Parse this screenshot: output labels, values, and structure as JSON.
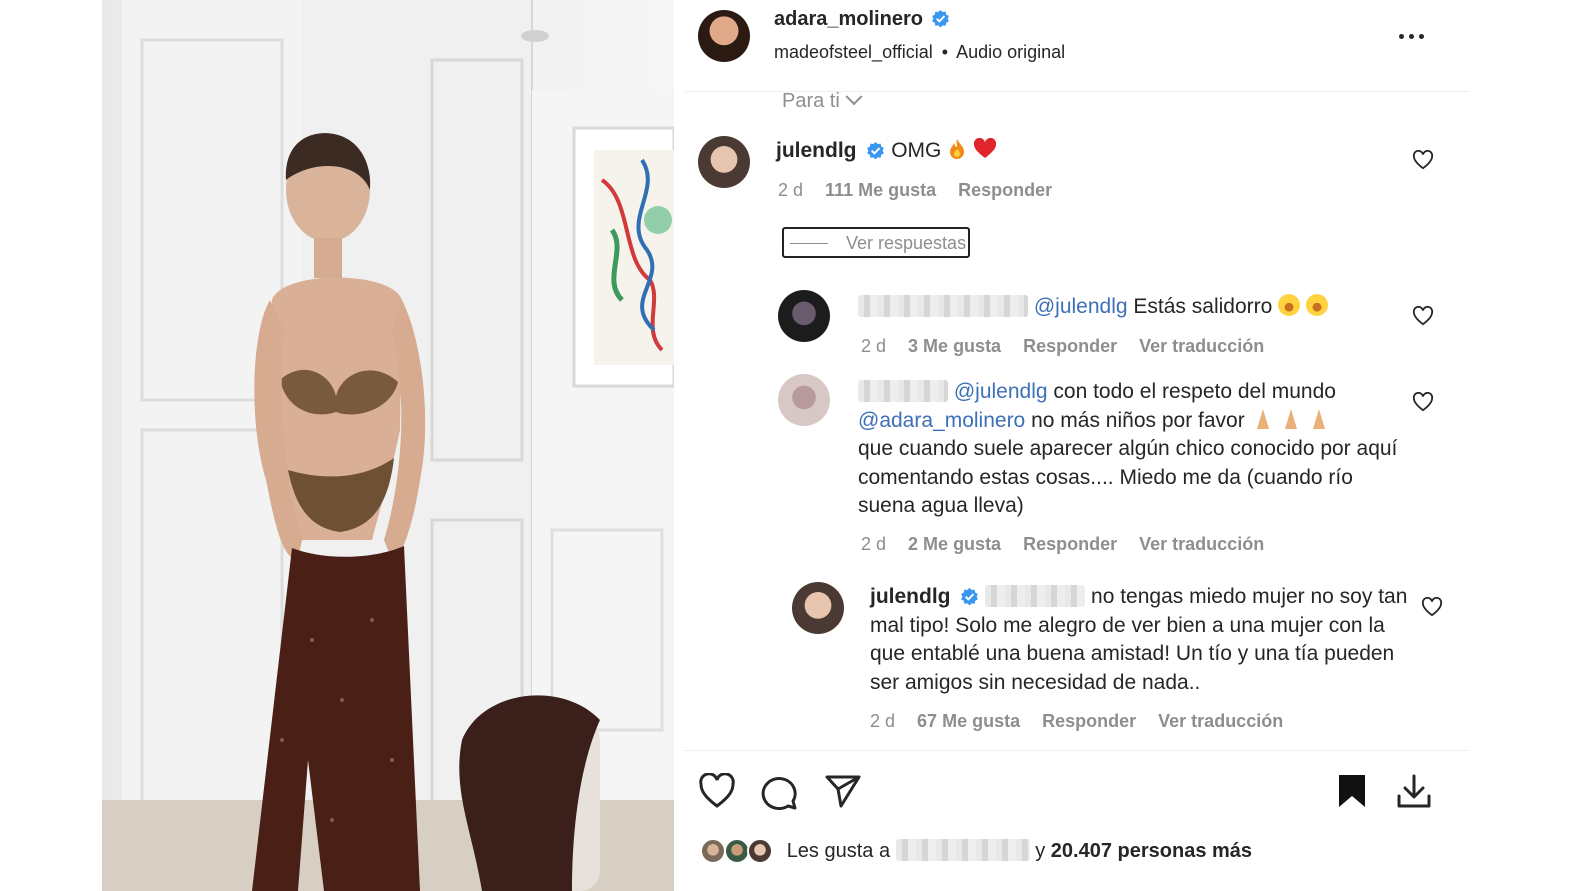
{
  "post": {
    "author": "adara_molinero",
    "audio_source": "madeofsteel_official",
    "audio_sep": "•",
    "audio_label": "Audio original"
  },
  "filter": {
    "label": "Para ti"
  },
  "comments": [
    {
      "user": "julendlg",
      "text": "OMG",
      "time": "2 d",
      "likes": "111 Me gusta",
      "reply": "Responder",
      "view_replies": "Ver respuestas"
    },
    {
      "mention": "@julendlg",
      "text": "Estás salidorro",
      "time": "2 d",
      "likes": "3 Me gusta",
      "reply": "Responder",
      "translate": "Ver traducción"
    },
    {
      "mention1": "@julendlg",
      "text1": "con todo el respeto del mundo",
      "mention2": "@adara_molinero",
      "text2": "no más niños por favor",
      "text3": "que cuando suele aparecer algún chico conocido por aquí comentando estas cosas.... Miedo me da (cuando río suena agua lleva)",
      "time": "2 d",
      "likes": "2 Me gusta",
      "reply": "Responder",
      "translate": "Ver traducción"
    },
    {
      "user": "julendlg",
      "text": "no tengas miedo mujer no soy tan mal tipo! Solo me alegro de ver bien a una mujer con la que entablé una buena amistad! Un tío y una tía pueden ser amigos sin necesidad de nada..",
      "time": "2 d",
      "likes": "67 Me gusta",
      "reply": "Responder",
      "translate": "Ver traducción"
    }
  ],
  "footer": {
    "likes_prefix": "Les gusta a",
    "likes_suffix": "y",
    "likes_count": "20.407 personas más"
  },
  "icons": [
    "verified-badge-icon",
    "more-options-icon",
    "chevron-down-icon",
    "heart-icon",
    "comment-icon",
    "share-icon",
    "bookmark-icon",
    "download-icon"
  ],
  "colors": {
    "verified": "#3897f0",
    "mention": "#3e70b8",
    "muted": "#8e8e8e",
    "text": "#262626"
  }
}
